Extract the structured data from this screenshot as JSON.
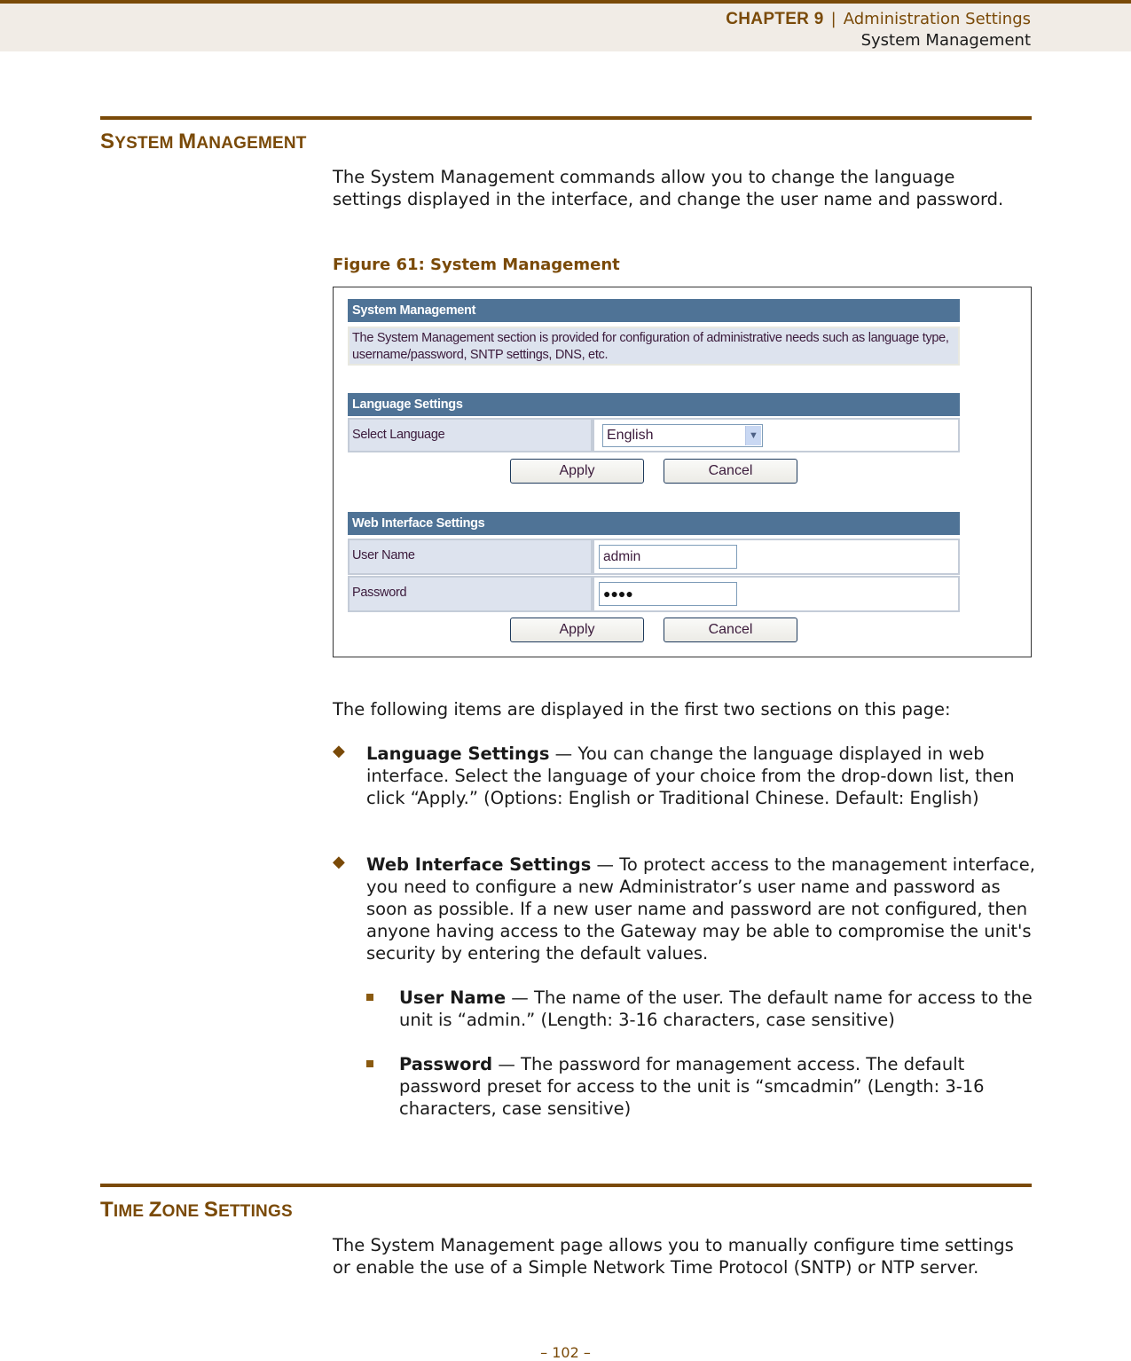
{
  "header": {
    "chapter_label": "CHAPTER 9",
    "separator": "|",
    "chapter_title": "Administration Settings",
    "section_title": "System Management"
  },
  "section1": {
    "title_first_cap": "S",
    "title_rest1": "YSTEM ",
    "title_second_cap": "M",
    "title_rest2": "ANAGEMENT",
    "intro": "The System Management commands allow you to change the language settings displayed in the interface, and change the user name and password.",
    "figure_caption": "Figure 61:  System Management"
  },
  "figure": {
    "system_management": {
      "header": "System Management",
      "description": "The System Management section is provided for configuration of administrative needs such as language type, username/password, SNTP settings, DNS, etc."
    },
    "language_settings": {
      "header": "Language Settings",
      "select_language_label": "Select Language",
      "select_language_value": "English",
      "apply_label": "Apply",
      "cancel_label": "Cancel"
    },
    "web_interface_settings": {
      "header": "Web Interface Settings",
      "user_name_label": "User Name",
      "user_name_value": "admin",
      "password_label": "Password",
      "password_value_masked": "●●●●",
      "apply_label": "Apply",
      "cancel_label": "Cancel"
    }
  },
  "items_intro": "The following items are displayed in the first two sections on this page:",
  "items": [
    {
      "term": "Language Settings",
      "description": " — You can change the language displayed in web interface. Select the language of your choice from the drop-down list, then click “Apply.” (Options: English or Traditional Chinese. Default: English)"
    },
    {
      "term": "Web Interface Settings",
      "description": " — To protect access to the management interface, you need to configure a new Administrator’s user name and password as soon as possible. If a new user name and password are not configured, then anyone having access to the Gateway may be able to compromise the unit's security by entering the default values.",
      "subitems": [
        {
          "term": "User Name",
          "description": " — The name of the user. The default name for access to the unit is “admin.” (Length: 3-16 characters, case sensitive)"
        },
        {
          "term": "Password",
          "description": " — The password for management access. The default password preset for access to the unit is “smcadmin” (Length: 3-16 characters, case sensitive)"
        }
      ]
    }
  ],
  "section2": {
    "title_first_cap": "T",
    "title_rest1": "IME ",
    "title_second_cap": "Z",
    "title_rest2": "ONE ",
    "title_third_cap": "S",
    "title_rest3": "ETTINGS",
    "intro": "The System Management page allows you to manually configure time settings or enable the use of a Simple Network Time Protocol (SNTP) or NTP server."
  },
  "footer": {
    "page_number": "–  102  –"
  },
  "colors": {
    "brand_brown": "#7a4a08",
    "panel_header_blue": "#4f7396",
    "row_label_bg": "#dde3ee",
    "header_band_bg": "#f1ece6"
  }
}
